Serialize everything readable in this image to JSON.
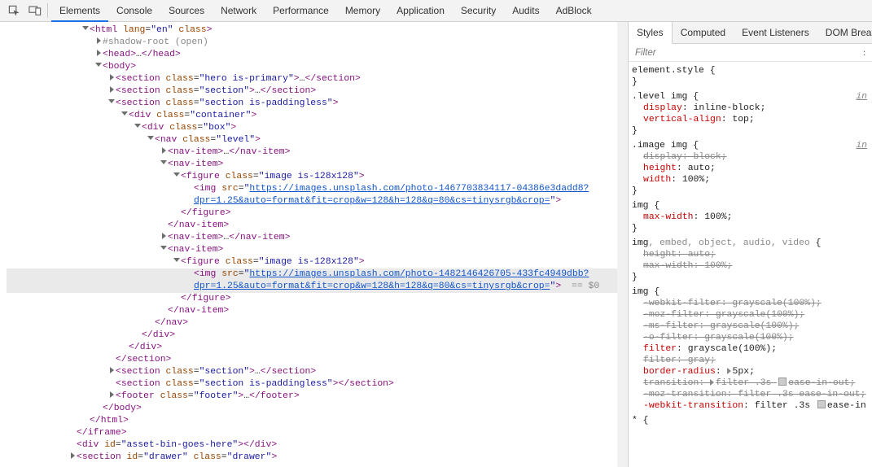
{
  "top_tabs": {
    "elements": "Elements",
    "console": "Console",
    "sources": "Sources",
    "network": "Network",
    "performance": "Performance",
    "memory": "Memory",
    "application": "Application",
    "security": "Security",
    "audits": "Audits",
    "adblock": "AdBlock"
  },
  "styles_tabs": {
    "styles": "Styles",
    "computed": "Computed",
    "event_listeners": "Event Listeners",
    "dom_breakpoints": "DOM Breakpoints"
  },
  "filter_placeholder": "Filter",
  "selected_suffix": " == $0",
  "dom": {
    "html_open": "<html lang=\"en\" class>",
    "shadow_root": "#shadow-root (open)",
    "head": "<head>…</head>",
    "body_open": "<body>",
    "section_hero": "<section class=\"hero is-primary\">…</section>",
    "section_plain": "<section class=\"section\">…</section>",
    "section_paddingless_open": "<section class=\"section is-paddingless\">",
    "div_container_open": "<div class=\"container\">",
    "div_box_open": "<div class=\"box\">",
    "nav_level_open": "<nav class=\"level\">",
    "nav_item_collapsed": "<nav-item>…</nav-item>",
    "nav_item_open": "<nav-item>",
    "figure_open": "<figure class=\"image is-128x128\">",
    "img1_a": "<img src=\"",
    "img1_url_l1": "https://images.unsplash.com/photo-1467703834117-04386e3dadd8?",
    "img1_url_l2": "dpr=1.25&auto=format&fit=crop&w=128&h=128&q=80&cs=tinysrgb&crop=",
    "img1_c": "\">",
    "img2_url_l1": "https://images.unsplash.com/photo-1482146426705-433fc4949dbb?",
    "img2_url_l2": "dpr=1.25&auto=format&fit=crop&w=128&h=128&q=80&cs=tinysrgb&crop=",
    "figure_close": "</figure>",
    "nav_item_close": "</nav-item>",
    "nav_close": "</nav>",
    "div_close": "</div>",
    "section_close": "</section>",
    "section_paddingless_empty": "<section class=\"section is-paddingless\"></section>",
    "footer": "<footer class=\"footer\">…</footer>",
    "body_close": "</body>",
    "html_close": "</html>",
    "iframe_close": "</iframe>",
    "div_asset": "<div id=\"asset-bin-goes-here\"></div>",
    "section_drawer": "<section id=\"drawer\" class=\"drawer\">"
  },
  "css": {
    "elem_style_sel": "element.style {",
    "close": "}",
    "level_img_sel": ".level img {",
    "display_ib": "display: inline-block;",
    "valign_top": "vertical-align: top;",
    "image_img_sel": ".image img {",
    "display_block": "display: block;",
    "height_auto": "height: auto;",
    "width_100": "width: 100%;",
    "img_sel": "img {",
    "maxw_100": "max-width: 100%;",
    "media_sel": "img, embed, object, audio, video {",
    "height_auto2": "height: auto;",
    "maxw_100_2": "max-width: 100%;",
    "img_sel2": "img {",
    "wk_filter": "-webkit-filter: grayscale(100%);",
    "moz_filter": "-moz-filter: grayscale(100%);",
    "ms_filter": "-ms-filter: grayscale(100%);",
    "o_filter": "-o-filter: grayscale(100%);",
    "filter_gs": "filter: grayscale(100%);",
    "filter_gray": "filter: gray;",
    "border_radius": "border-radius:  5px;",
    "transition": "transition:  filter .3s  ease-in-out;",
    "moz_transition": "-moz-transition: filter .3s ease-in-out;",
    "wk_transition": "-webkit-transition: filter .3s  ease-in",
    "star_sel": "* {",
    "inherit1": "in",
    "inherit2": "in"
  }
}
